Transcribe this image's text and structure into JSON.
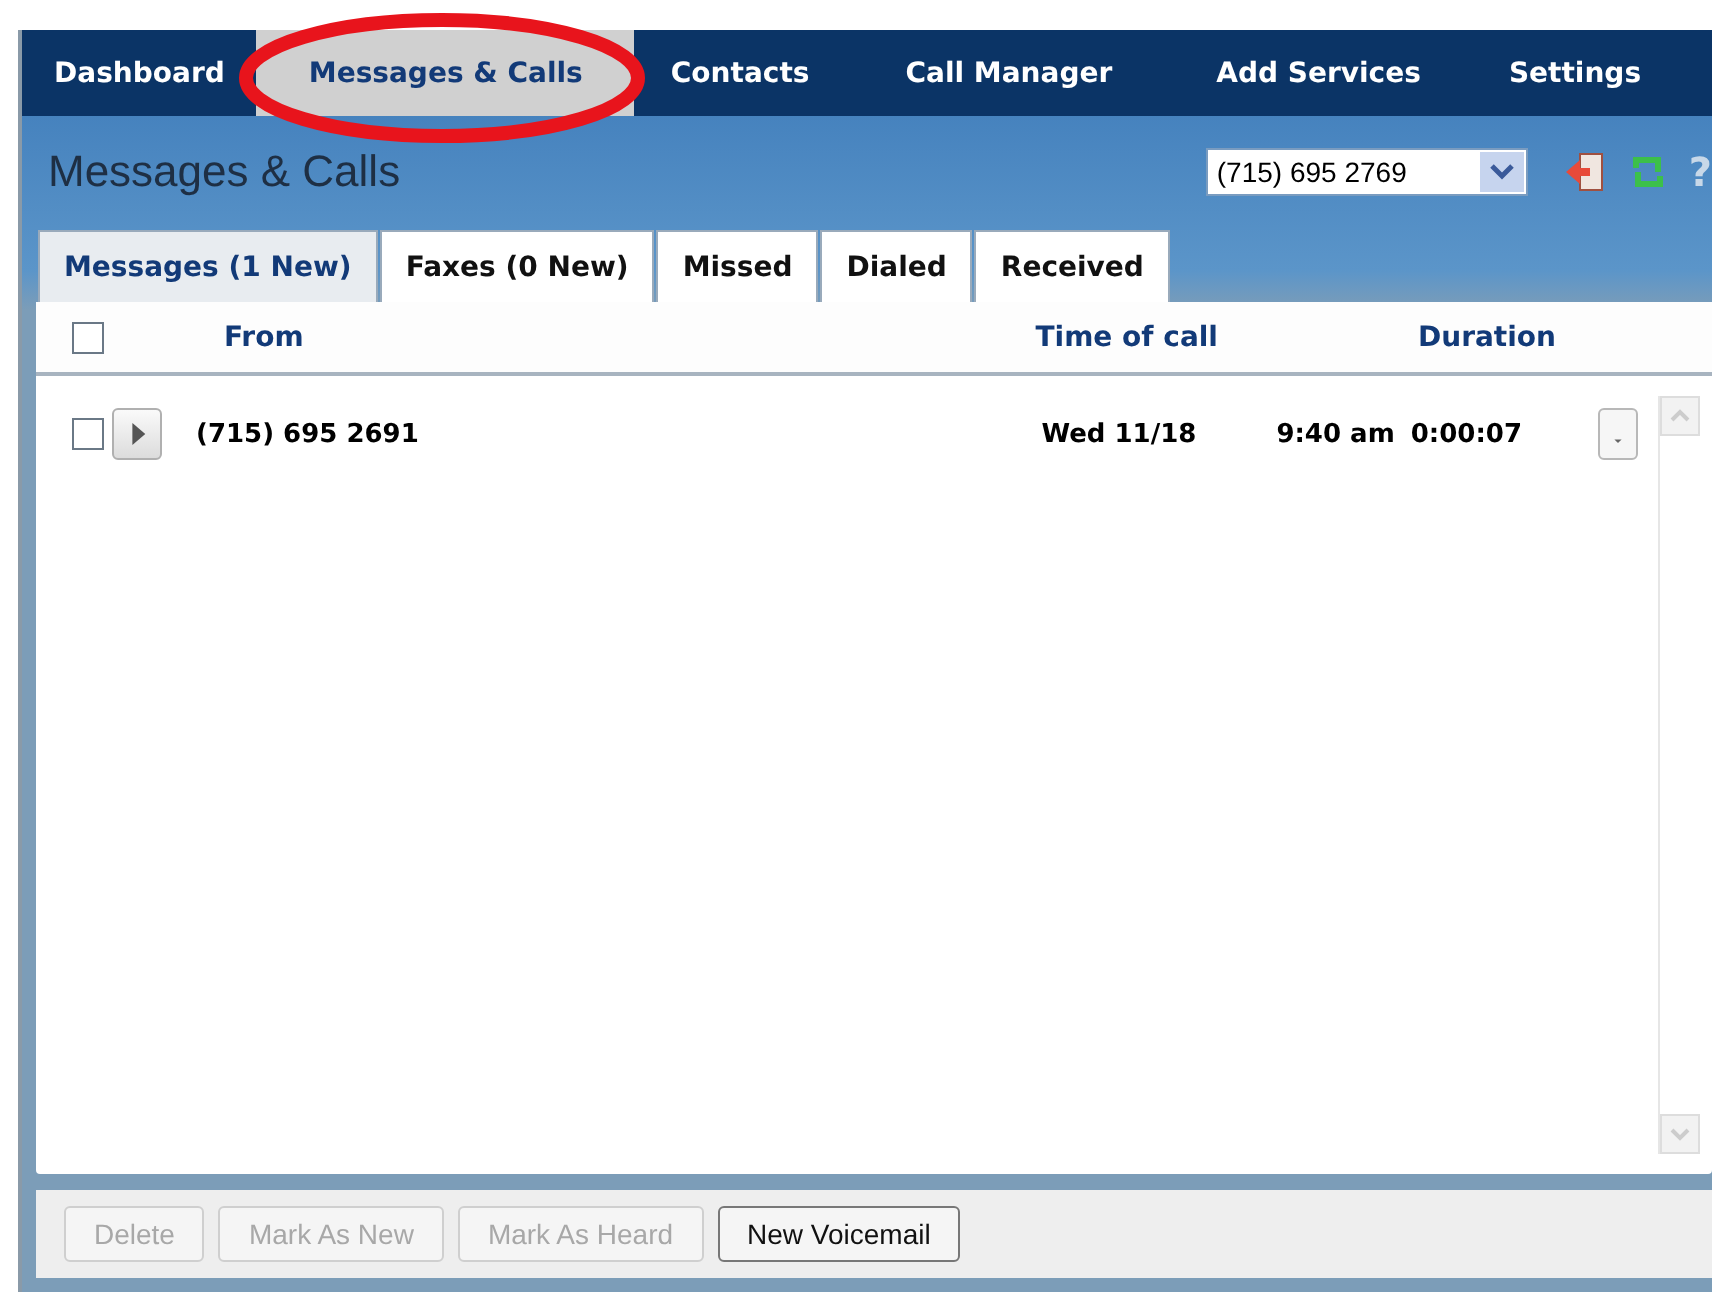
{
  "nav": [
    {
      "label": "Dashboard",
      "selected": false,
      "circled": false
    },
    {
      "label": "Messages & Calls",
      "selected": true,
      "circled": true
    },
    {
      "label": "Contacts",
      "selected": false,
      "circled": false
    },
    {
      "label": "Call Manager",
      "selected": false,
      "circled": false
    },
    {
      "label": "Add Services",
      "selected": false,
      "circled": false
    },
    {
      "label": "Settings",
      "selected": false,
      "circled": false
    }
  ],
  "page_title": "Messages & Calls",
  "line_select": {
    "value": "(715) 695 2769"
  },
  "help": "?",
  "tabs": [
    {
      "label": "Messages (1 New)",
      "selected": true
    },
    {
      "label": "Faxes (0 New)",
      "selected": false
    },
    {
      "label": "Missed",
      "selected": false
    },
    {
      "label": "Dialed",
      "selected": false
    },
    {
      "label": "Received",
      "selected": false
    }
  ],
  "table": {
    "columns": [
      "From",
      "Time of call",
      "Duration"
    ],
    "select_all_checked": false,
    "rows": [
      {
        "checked": false,
        "from": "(715) 695 2691",
        "date": "Wed 11/18",
        "time": "9:40 am",
        "duration": "0:00:07"
      }
    ]
  },
  "buttons": [
    {
      "label": "Delete",
      "disabled": true
    },
    {
      "label": "Mark As New",
      "disabled": true
    },
    {
      "label": "Mark As Heard",
      "disabled": true
    },
    {
      "label": "New Voicemail",
      "disabled": false
    }
  ]
}
